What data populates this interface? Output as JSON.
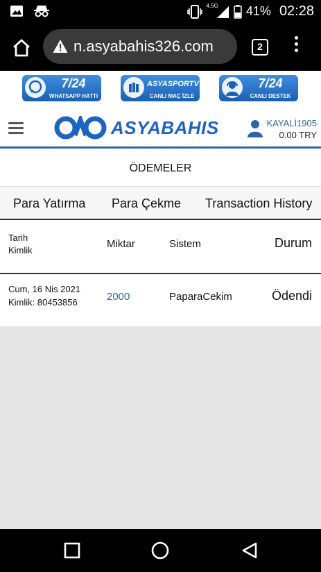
{
  "status_bar": {
    "network_label": "4.5G",
    "battery_percent": "41%",
    "time": "02:28"
  },
  "browser": {
    "url": "n.asyabahis326.com",
    "tab_count": "2"
  },
  "banners": [
    {
      "title": "7/24",
      "subtitle": "WHATSAPP HATTI"
    },
    {
      "title": "ASYASPORTV",
      "subtitle": "CANLI MAÇ İZLE"
    },
    {
      "title": "7/24",
      "subtitle": "CANLI DESTEK"
    }
  ],
  "header": {
    "logo_text": "ASYABAHIS",
    "username": "KAYALİ1905",
    "balance": "0.00 TRY"
  },
  "section_title": "ÖDEMELER",
  "tabs": [
    {
      "label": "Para Yatırma"
    },
    {
      "label": "Para Çekme"
    },
    {
      "label": "Transaction History"
    }
  ],
  "table": {
    "headers": {
      "date": "Tarih",
      "id": "Kimlik",
      "amount": "Miktar",
      "system": "Sistem",
      "status": "Durum"
    },
    "rows": [
      {
        "date": "Cum, 16 Nis 2021",
        "id": "Kimlik: 80453856",
        "amount": "2000",
        "system": "PaparaCekim",
        "status": "Ödendi"
      }
    ]
  },
  "colors": {
    "brand_blue": "#1d64c2",
    "link_blue": "#2c65a8",
    "page_background": "#e6e6e6"
  }
}
